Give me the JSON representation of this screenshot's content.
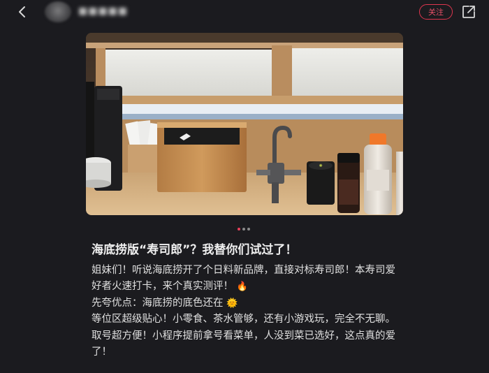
{
  "header": {
    "username": "■■■■■",
    "follow_label": "关注"
  },
  "carousel": {
    "total": 3,
    "active_index": 0
  },
  "post": {
    "title": "海底捞版“寿司郎”？我替你们试过了！",
    "paragraphs": [
      {
        "text": "姐妹们！听说海底捞开了个日料新品牌，直接对标寿司郎！本寿司爱好者火速打卡，来个真实测评！",
        "emoji": "🔥"
      },
      {
        "text": "先夸优点：海底捞的底色还在",
        "emoji": "🌞"
      },
      {
        "text": "等位区超级贴心！小零食、茶水管够，还有小游戏玩，完全不无聊。",
        "emoji": ""
      },
      {
        "text": "取号超方便！小程序提前拿号看菜单，人没到菜已选好，这点真的爱了！",
        "emoji": ""
      }
    ]
  },
  "colors": {
    "background": "#1b1b1f",
    "accent": "#e0364f",
    "text": "#e6e6e6"
  },
  "icons": {
    "back": "chevron-left-icon",
    "share": "share-icon"
  }
}
